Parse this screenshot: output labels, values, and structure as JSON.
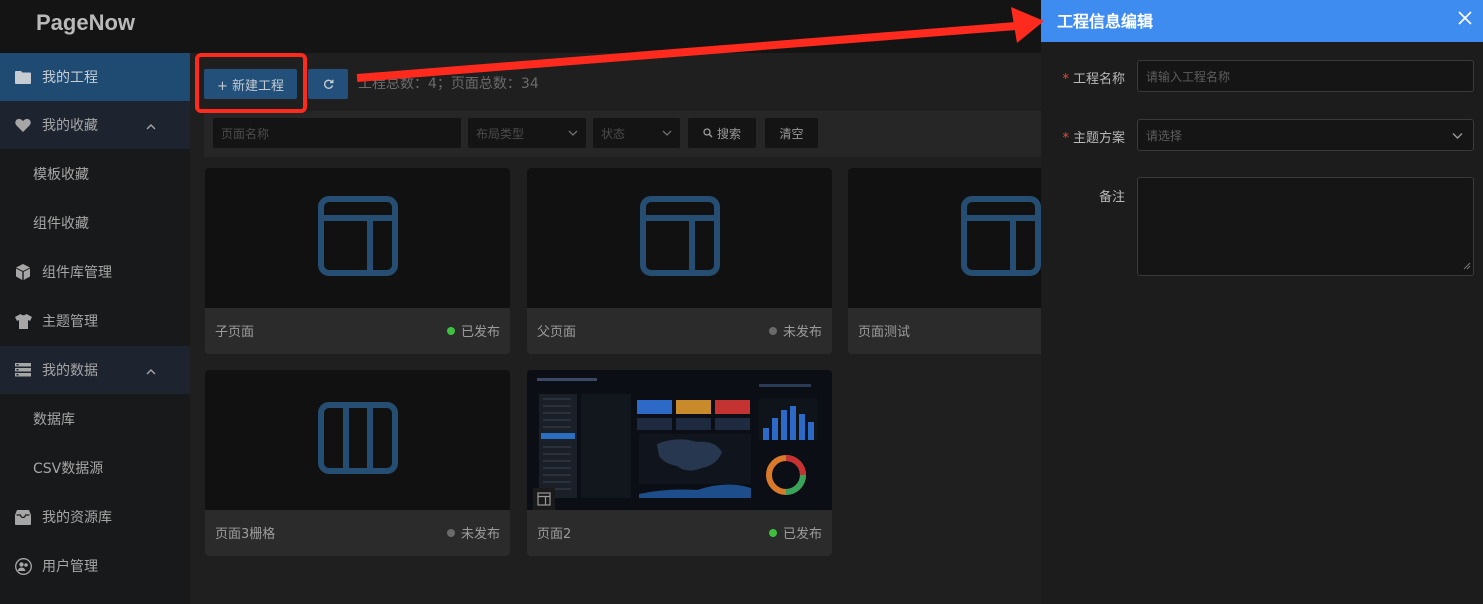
{
  "app": {
    "logo": "PageNow"
  },
  "sidebar": {
    "items": [
      {
        "label": "我的工程",
        "icon": "folder-icon"
      },
      {
        "label": "我的收藏",
        "icon": "heart-icon"
      },
      {
        "label": "模板收藏"
      },
      {
        "label": "组件收藏"
      },
      {
        "label": "组件库管理",
        "icon": "cube-icon"
      },
      {
        "label": "主题管理",
        "icon": "tshirt-icon"
      },
      {
        "label": "我的数据",
        "icon": "database-icon"
      },
      {
        "label": "数据库"
      },
      {
        "label": "CSV数据源"
      },
      {
        "label": "我的资源库",
        "icon": "archive-icon"
      },
      {
        "label": "用户管理",
        "icon": "users-icon"
      }
    ]
  },
  "toolbar": {
    "new_label": "+ 新建工程",
    "stats": "工程总数：4；页面总数：34"
  },
  "filters": {
    "page_name_placeholder": "页面名称",
    "layout_type_placeholder": "布局类型",
    "status_placeholder": "状态",
    "search_label": "搜索",
    "clear_label": "清空"
  },
  "cards": [
    {
      "name": "子页面",
      "status": "已发布",
      "status_color": "#3fbf3f"
    },
    {
      "name": "父页面",
      "status": "未发布",
      "status_color": "#6a6a6a"
    },
    {
      "name": "页面测试",
      "status": "",
      "status_color": ""
    },
    {
      "name": "页面3栅格",
      "status": "未发布",
      "status_color": "#6a6a6a"
    },
    {
      "name": "页面2",
      "status": "已发布",
      "status_color": "#3fbf3f"
    }
  ],
  "drawer": {
    "title": "工程信息编辑",
    "name_label": "工程名称",
    "name_placeholder": "请输入工程名称",
    "theme_label": "主题方案",
    "theme_placeholder": "请选择",
    "remark_label": "备注"
  },
  "colors": {
    "accent": "#3f8cf0",
    "annotation": "#ff2a1e",
    "active_nav": "#1f4b72"
  }
}
